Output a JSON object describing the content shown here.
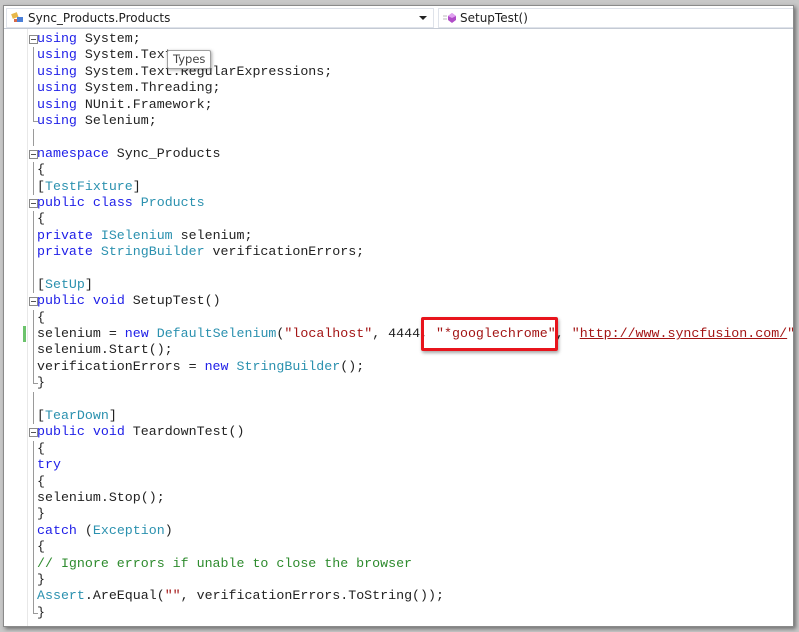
{
  "navbar": {
    "type_combo": {
      "label": "Sync_Products.Products",
      "icon": "class-icon"
    },
    "member_combo": {
      "label": "SetupTest()",
      "icon": "method-icon"
    }
  },
  "tooltip": {
    "text": "Types"
  },
  "colors": {
    "keyword": "#2020e8",
    "type": "#2b91af",
    "string": "#a31515",
    "comment": "#2e8b2e",
    "highlight": "#e8141c"
  },
  "code": {
    "lines": [
      [
        [
          "kw",
          "using"
        ],
        [
          "pl",
          " System;"
        ]
      ],
      [
        [
          "kw",
          "using"
        ],
        [
          "pl",
          " System.Text;"
        ]
      ],
      [
        [
          "kw",
          "using"
        ],
        [
          "pl",
          " System.Text.RegularExpressions;"
        ]
      ],
      [
        [
          "kw",
          "using"
        ],
        [
          "pl",
          " System.Threading;"
        ]
      ],
      [
        [
          "kw",
          "using"
        ],
        [
          "pl",
          " NUnit.Framework;"
        ]
      ],
      [
        [
          "kw",
          "using"
        ],
        [
          "pl",
          " Selenium;"
        ]
      ],
      [],
      [
        [
          "kw",
          "namespace"
        ],
        [
          "pl",
          " Sync_Products"
        ]
      ],
      [
        [
          "pl",
          "{"
        ]
      ],
      [
        [
          "pl",
          "["
        ],
        [
          "ty",
          "TestFixture"
        ],
        [
          "pl",
          "]"
        ]
      ],
      [
        [
          "kw",
          "public"
        ],
        [
          "pl",
          " "
        ],
        [
          "kw",
          "class"
        ],
        [
          "pl",
          " "
        ],
        [
          "ty",
          "Products"
        ]
      ],
      [
        [
          "pl",
          "{"
        ]
      ],
      [
        [
          "kw",
          "private"
        ],
        [
          "pl",
          " "
        ],
        [
          "ty",
          "ISelenium"
        ],
        [
          "pl",
          " selenium;"
        ]
      ],
      [
        [
          "kw",
          "private"
        ],
        [
          "pl",
          " "
        ],
        [
          "ty",
          "StringBuilder"
        ],
        [
          "pl",
          " verificationErrors;"
        ]
      ],
      [],
      [
        [
          "pl",
          "["
        ],
        [
          "ty",
          "SetUp"
        ],
        [
          "pl",
          "]"
        ]
      ],
      [
        [
          "kw",
          "public"
        ],
        [
          "pl",
          " "
        ],
        [
          "kw",
          "void"
        ],
        [
          "pl",
          " SetupTest()"
        ]
      ],
      [
        [
          "pl",
          "{"
        ]
      ],
      [
        [
          "pl",
          "selenium = "
        ],
        [
          "kw",
          "new"
        ],
        [
          "pl",
          " "
        ],
        [
          "ty",
          "DefaultSelenium"
        ],
        [
          "pl",
          "("
        ],
        [
          "st",
          "\"localhost\""
        ],
        [
          "pl",
          ", 4444, "
        ],
        [
          "st",
          "\"*googlechrome\""
        ],
        [
          "pl",
          ", "
        ],
        [
          "st",
          "\""
        ],
        [
          "url",
          "http://www.syncfusion.com/"
        ],
        [
          "st",
          "\""
        ],
        [
          "pl",
          ");"
        ]
      ],
      [
        [
          "pl",
          "selenium.Start();"
        ]
      ],
      [
        [
          "pl",
          "verificationErrors = "
        ],
        [
          "kw",
          "new"
        ],
        [
          "pl",
          " "
        ],
        [
          "ty",
          "StringBuilder"
        ],
        [
          "pl",
          "();"
        ]
      ],
      [
        [
          "pl",
          "}"
        ]
      ],
      [],
      [
        [
          "pl",
          "["
        ],
        [
          "ty",
          "TearDown"
        ],
        [
          "pl",
          "]"
        ]
      ],
      [
        [
          "kw",
          "public"
        ],
        [
          "pl",
          " "
        ],
        [
          "kw",
          "void"
        ],
        [
          "pl",
          " TeardownTest()"
        ]
      ],
      [
        [
          "pl",
          "{"
        ]
      ],
      [
        [
          "kw",
          "try"
        ]
      ],
      [
        [
          "pl",
          "{"
        ]
      ],
      [
        [
          "pl",
          "selenium.Stop();"
        ]
      ],
      [
        [
          "pl",
          "}"
        ]
      ],
      [
        [
          "kw",
          "catch"
        ],
        [
          "pl",
          " ("
        ],
        [
          "ty",
          "Exception"
        ],
        [
          "pl",
          ")"
        ]
      ],
      [
        [
          "pl",
          "{"
        ]
      ],
      [
        [
          "cm",
          "// Ignore errors if unable to close the browser"
        ]
      ],
      [
        [
          "pl",
          "}"
        ]
      ],
      [
        [
          "ty",
          "Assert"
        ],
        [
          "pl",
          ".AreEqual("
        ],
        [
          "st",
          "\"\""
        ],
        [
          "pl",
          ", verificationErrors.ToString());"
        ]
      ],
      [
        [
          "pl",
          "}"
        ]
      ]
    ],
    "collapsible_lines": [
      0,
      7,
      10,
      16,
      24
    ],
    "block_end_lines": [
      5,
      21,
      35
    ],
    "changed_lines": [
      18
    ]
  }
}
